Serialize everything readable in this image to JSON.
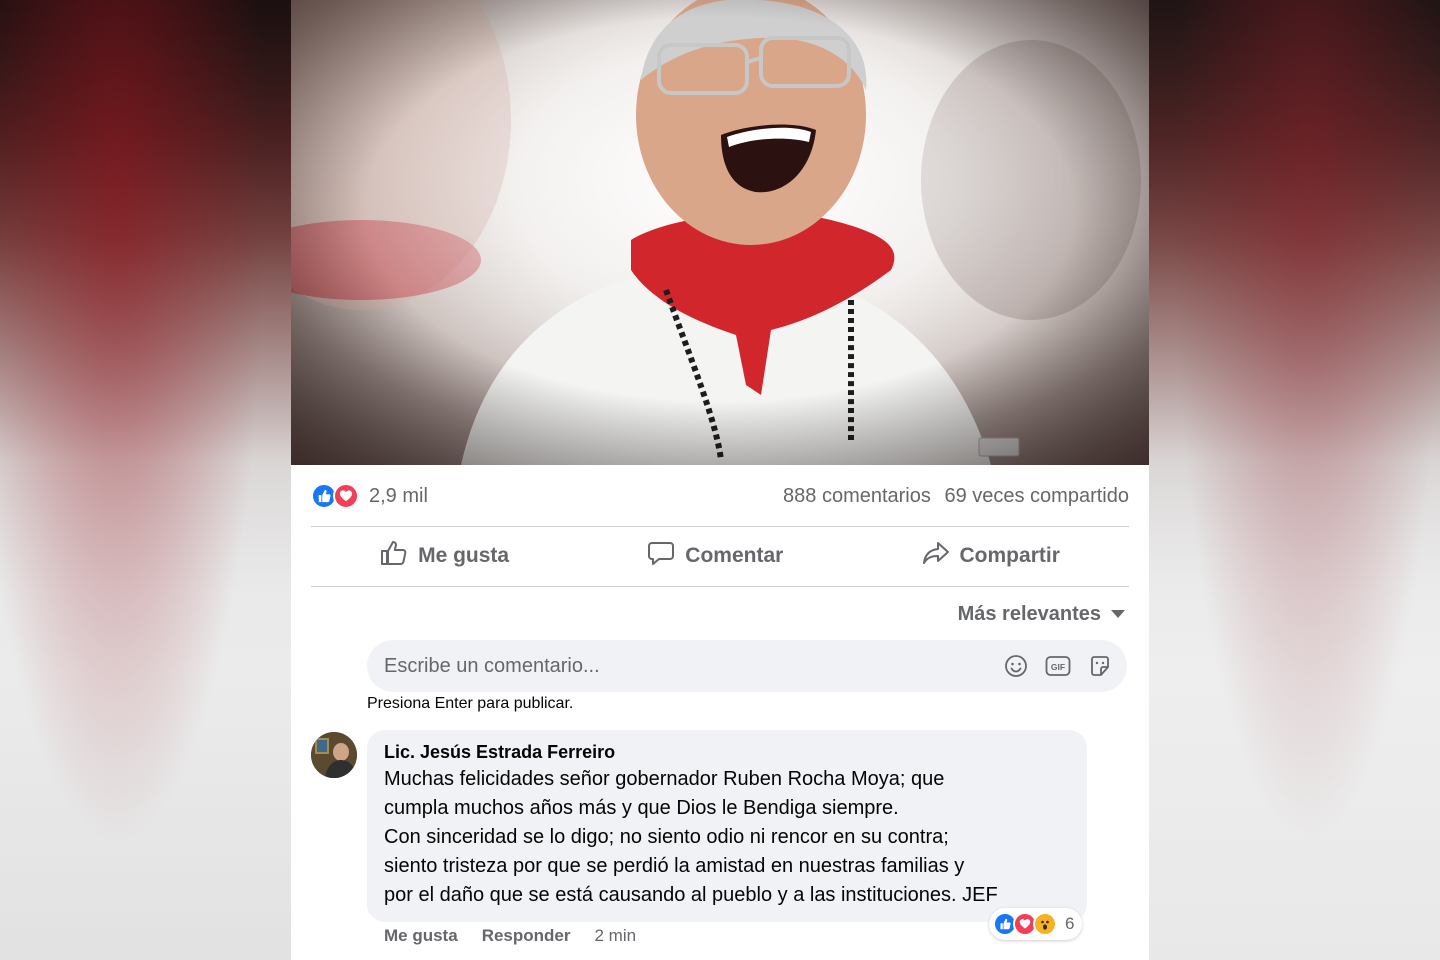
{
  "post": {
    "reaction_count": "2,9 mil",
    "comments_count": "888 comentarios",
    "shares_count": "69 veces compartido",
    "reaction_icons": [
      "like-icon",
      "love-icon"
    ]
  },
  "actions": {
    "like": "Me gusta",
    "comment": "Comentar",
    "share": "Compartir"
  },
  "sort": {
    "label": "Más relevantes"
  },
  "composer": {
    "placeholder": "Escribe un comentario...",
    "hint": "Presiona Enter para publicar.",
    "icons": [
      "emoji-icon",
      "gif-icon",
      "sticker-icon"
    ]
  },
  "comment": {
    "author": "Lic. Jesús Estrada Ferreiro",
    "lines": [
      "Muchas felicidades señor gobernador Ruben Rocha Moya; que",
      "cumpla muchos años más y que Dios le Bendiga siempre.",
      "Con sinceridad se lo digo; no siento odio ni rencor en su contra;",
      "siento tristeza por que se perdió la amistad en nuestras familias y",
      "por el daño que se está causando al pueblo y a las instituciones. JEF"
    ],
    "reaction_count": "6",
    "reaction_icons": [
      "like-icon",
      "love-icon",
      "wow-icon"
    ],
    "like_label": "Me gusta",
    "reply_label": "Responder",
    "time": "2 min"
  },
  "colors": {
    "facebook_blue": "#1877f2",
    "love_red": "#f33e58",
    "wow_yellow": "#f7b125",
    "bandana_red": "#d1262c"
  }
}
